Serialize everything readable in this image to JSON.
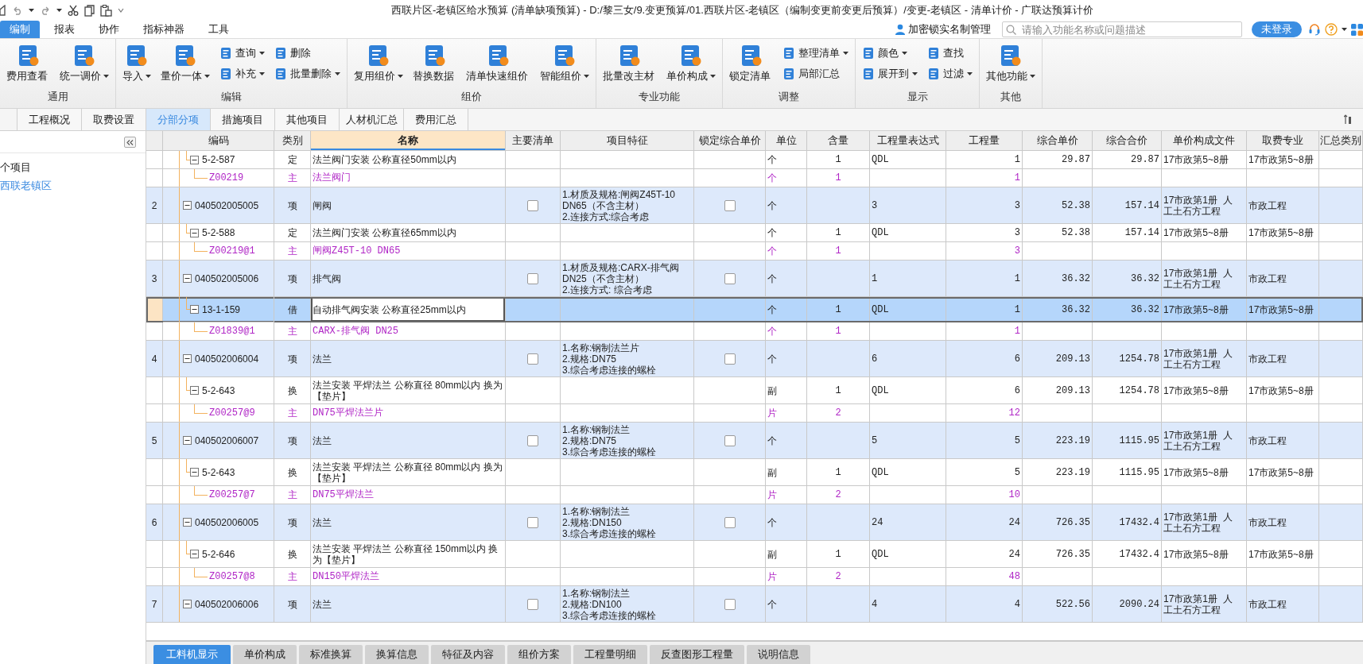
{
  "title_bar": {
    "title": "西联片区-老镇区给水预算 (清单缺项预算) - D:/黎三女/9.变更预算/01.西联片区-老镇区（编制变更前变更后预算）/变更-老镇区 - 清单计价 - 广联达预算计价"
  },
  "menu": {
    "tabs": [
      {
        "label": "编制",
        "selected": true
      },
      {
        "label": "报表",
        "selected": false
      },
      {
        "label": "协作",
        "selected": false
      },
      {
        "label": "指标神器",
        "selected": false
      },
      {
        "label": "工具",
        "selected": false
      }
    ],
    "lock_manager": "加密锁实名制管理",
    "search": {
      "placeholder": "请输入功能名称或问题描述"
    },
    "login_button": "未登录"
  },
  "ribbon": {
    "groups": [
      {
        "label": "通用",
        "items": [
          {
            "kind": "large",
            "label": "费用查看",
            "dropdown": false
          },
          {
            "kind": "large",
            "label": "统一调价",
            "dropdown": true
          }
        ]
      },
      {
        "label": "编辑",
        "items": [
          {
            "kind": "large",
            "label": "导入",
            "dropdown": true
          },
          {
            "kind": "large",
            "label": "量价一体",
            "dropdown": true
          },
          {
            "kind": "small",
            "label": "查询",
            "dropdown": true
          },
          {
            "kind": "small",
            "label": "补充",
            "dropdown": true
          },
          {
            "kind": "small",
            "label": "删除",
            "dropdown": false
          },
          {
            "kind": "small",
            "label": "批量删除",
            "dropdown": true
          }
        ]
      },
      {
        "label": "组价",
        "items": [
          {
            "kind": "large",
            "label": "复用组价",
            "dropdown": true
          },
          {
            "kind": "large",
            "label": "替换数据",
            "dropdown": false
          },
          {
            "kind": "large",
            "label": "清单快速组价",
            "dropdown": false
          },
          {
            "kind": "large",
            "label": "智能组价",
            "dropdown": true
          }
        ]
      },
      {
        "label": "专业功能",
        "items": [
          {
            "kind": "large",
            "label": "批量改主材",
            "dropdown": false
          },
          {
            "kind": "large",
            "label": "单价构成",
            "dropdown": true
          }
        ]
      },
      {
        "label": "调整",
        "items": [
          {
            "kind": "large",
            "label": "锁定清单",
            "dropdown": false
          },
          {
            "kind": "small",
            "label": "整理清单",
            "dropdown": true
          },
          {
            "kind": "small",
            "label": "局部汇总",
            "dropdown": false
          }
        ]
      },
      {
        "label": "显示",
        "items": [
          {
            "kind": "small",
            "label": "颜色",
            "dropdown": true
          },
          {
            "kind": "small",
            "label": "展开到",
            "dropdown": true
          },
          {
            "kind": "small",
            "label": "查找",
            "dropdown": false
          },
          {
            "kind": "small",
            "label": "过滤",
            "dropdown": true
          }
        ]
      },
      {
        "label": "其他",
        "items": [
          {
            "kind": "large",
            "label": "其他功能",
            "dropdown": true
          }
        ]
      }
    ]
  },
  "doc_tabs": [
    {
      "label": "工程概况",
      "selected": false
    },
    {
      "label": "取费设置",
      "selected": false
    },
    {
      "label": "分部分项",
      "selected": true
    },
    {
      "label": "措施项目",
      "selected": false
    },
    {
      "label": "其他项目",
      "selected": false
    },
    {
      "label": "人材机汇总",
      "selected": false
    },
    {
      "label": "费用汇总",
      "selected": false
    }
  ],
  "sidebar": {
    "items": [
      {
        "label": "个项目",
        "selected": false
      },
      {
        "label": "西联老镇区",
        "selected": true
      }
    ]
  },
  "table": {
    "columns": [
      {
        "label": "编码",
        "selected": false
      },
      {
        "label": "类别",
        "selected": false
      },
      {
        "label": "名称",
        "selected": true
      },
      {
        "label": "主要清单",
        "selected": false
      },
      {
        "label": "项目特征",
        "selected": false
      },
      {
        "label": "锁定综合单价",
        "selected": false
      },
      {
        "label": "单位",
        "selected": false
      },
      {
        "label": "含量",
        "selected": false
      },
      {
        "label": "工程量表达式",
        "selected": false
      },
      {
        "label": "工程量",
        "selected": false
      },
      {
        "label": "综合单价",
        "selected": false
      },
      {
        "label": "综合合价",
        "selected": false
      },
      {
        "label": "单价构成文件",
        "selected": false
      },
      {
        "label": "取费专业",
        "selected": false
      },
      {
        "label": "汇总类别",
        "selected": false
      }
    ],
    "rows": [
      {
        "kind": "quota",
        "selected": false,
        "expanded": true,
        "code": "5-2-587",
        "type": "定",
        "name": "法兰阀门安装 公称直径50mm以内",
        "unit": "个",
        "content": "1",
        "expr": "QDL",
        "qty": "1",
        "unit_price": "29.87",
        "total": "29.87",
        "price_file": "17市政第5~8册",
        "fee_type": "17市政第5~8册"
      },
      {
        "kind": "main",
        "selected": false,
        "code": "Z00219",
        "type": "主",
        "name": "法兰阀门",
        "unit": "个",
        "content": "1",
        "qty": "1"
      },
      {
        "kind": "item",
        "selected": false,
        "expanded": true,
        "index": "2",
        "code": "040502005005",
        "type": "项",
        "name": "闸阀",
        "main_list_checked": false,
        "features": "1.材质及规格:闸阀Z45T-10\nDN65（不含主材）\n2.连接方式:综合考虑",
        "price_locked": false,
        "unit": "个",
        "expr": "3",
        "qty": "3",
        "unit_price": "52.38",
        "total": "157.14",
        "price_file": "17市政第1册  人工土石方工程",
        "fee_type": "市政工程"
      },
      {
        "kind": "quota",
        "selected": false,
        "expanded": true,
        "code": "5-2-588",
        "type": "定",
        "name": "法兰阀门安装 公称直径65mm以内",
        "unit": "个",
        "content": "1",
        "expr": "QDL",
        "qty": "3",
        "unit_price": "52.38",
        "total": "157.14",
        "price_file": "17市政第5~8册",
        "fee_type": "17市政第5~8册"
      },
      {
        "kind": "main",
        "selected": false,
        "code": "Z00219@1",
        "type": "主",
        "name": "闸阀Z45T-10 DN65",
        "unit": "个",
        "content": "1",
        "qty": "3"
      },
      {
        "kind": "item",
        "selected": false,
        "expanded": true,
        "index": "3",
        "code": "040502005006",
        "type": "项",
        "name": "排气阀",
        "main_list_checked": false,
        "features": "1.材质及规格:CARX-排气阀\nDN25（不含主材）\n2.连接方式: 综合考虑",
        "price_locked": false,
        "unit": "个",
        "expr": "1",
        "qty": "1",
        "unit_price": "36.32",
        "total": "36.32",
        "price_file": "17市政第1册  人工土石方工程",
        "fee_type": "市政工程"
      },
      {
        "kind": "quota",
        "selected": true,
        "expanded": true,
        "code": "13-1-159",
        "type": "借",
        "name": "自动排气阀安装 公称直径25mm以内",
        "unit": "个",
        "content": "1",
        "expr": "QDL",
        "qty": "1",
        "unit_price": "36.32",
        "total": "36.32",
        "price_file": "17市政第5~8册",
        "fee_type": "17市政第5~8册"
      },
      {
        "kind": "main",
        "selected": false,
        "code": "Z01839@1",
        "type": "主",
        "name": "CARX-排气阀 DN25",
        "unit": "个",
        "content": "1",
        "qty": "1"
      },
      {
        "kind": "item",
        "selected": false,
        "expanded": true,
        "index": "4",
        "code": "040502006004",
        "type": "项",
        "name": "法兰",
        "main_list_checked": false,
        "features": "1.名称:钢制法兰片\n2.规格:DN75\n3.综合考虑连接的螺栓",
        "price_locked": false,
        "unit": "个",
        "expr": "6",
        "qty": "6",
        "unit_price": "209.13",
        "total": "1254.78",
        "price_file": "17市政第1册  人工土石方工程",
        "fee_type": "市政工程"
      },
      {
        "kind": "quota",
        "selected": false,
        "expanded": true,
        "code": "5-2-643",
        "type": "换",
        "name": "法兰安装 平焊法兰 公称直径 80mm以内  换为【垫片】",
        "unit": "副",
        "content": "1",
        "expr": "QDL",
        "qty": "6",
        "unit_price": "209.13",
        "total": "1254.78",
        "price_file": "17市政第5~8册",
        "fee_type": "17市政第5~8册"
      },
      {
        "kind": "main",
        "selected": false,
        "code": "Z00257@9",
        "type": "主",
        "name": "DN75平焊法兰片",
        "unit": "片",
        "content": "2",
        "qty": "12"
      },
      {
        "kind": "item",
        "selected": false,
        "expanded": true,
        "index": "5",
        "code": "040502006007",
        "type": "项",
        "name": "法兰",
        "main_list_checked": false,
        "features": "1.名称:钢制法兰\n2.规格:DN75\n3.综合考虑连接的螺栓",
        "price_locked": false,
        "unit": "个",
        "expr": "5",
        "qty": "5",
        "unit_price": "223.19",
        "total": "1115.95",
        "price_file": "17市政第1册  人工土石方工程",
        "fee_type": "市政工程"
      },
      {
        "kind": "quota",
        "selected": false,
        "expanded": true,
        "code": "5-2-643",
        "type": "换",
        "name": "法兰安装 平焊法兰 公称直径 80mm以内  换为【垫片】",
        "unit": "副",
        "content": "1",
        "expr": "QDL",
        "qty": "5",
        "unit_price": "223.19",
        "total": "1115.95",
        "price_file": "17市政第5~8册",
        "fee_type": "17市政第5~8册"
      },
      {
        "kind": "main",
        "selected": false,
        "code": "Z00257@7",
        "type": "主",
        "name": "DN75平焊法兰",
        "unit": "片",
        "content": "2",
        "qty": "10"
      },
      {
        "kind": "item",
        "selected": false,
        "expanded": true,
        "index": "6",
        "code": "040502006005",
        "type": "项",
        "name": "法兰",
        "main_list_checked": false,
        "features": "1.名称:钢制法兰\n2.规格:DN150\n3.综合考虑连接的螺栓",
        "price_locked": false,
        "unit": "个",
        "expr": "24",
        "qty": "24",
        "unit_price": "726.35",
        "total": "17432.4",
        "price_file": "17市政第1册  人工土石方工程",
        "fee_type": "市政工程"
      },
      {
        "kind": "quota",
        "selected": false,
        "expanded": true,
        "code": "5-2-646",
        "type": "换",
        "name": "法兰安装 平焊法兰 公称直径 150mm以内 换为【垫片】",
        "unit": "副",
        "content": "1",
        "expr": "QDL",
        "qty": "24",
        "unit_price": "726.35",
        "total": "17432.4",
        "price_file": "17市政第5~8册",
        "fee_type": "17市政第5~8册"
      },
      {
        "kind": "main",
        "selected": false,
        "code": "Z00257@8",
        "type": "主",
        "name": "DN150平焊法兰",
        "unit": "片",
        "content": "2",
        "qty": "48"
      },
      {
        "kind": "item",
        "selected": false,
        "expanded": true,
        "index": "7",
        "code": "040502006006",
        "type": "项",
        "name": "法兰",
        "main_list_checked": false,
        "features": "1.名称:钢制法兰\n2.规格:DN100\n3.综合考虑连接的螺栓",
        "price_locked": false,
        "unit": "个",
        "expr": "4",
        "qty": "4",
        "unit_price": "522.56",
        "total": "2090.24",
        "price_file": "17市政第1册  人工土石方工程",
        "fee_type": "市政工程"
      }
    ]
  },
  "bottom_tabs": [
    {
      "label": "工料机显示",
      "selected": true
    },
    {
      "label": "单价构成",
      "selected": false
    },
    {
      "label": "标准换算",
      "selected": false
    },
    {
      "label": "换算信息",
      "selected": false
    },
    {
      "label": "特征及内容",
      "selected": false
    },
    {
      "label": "组价方案",
      "selected": false
    },
    {
      "label": "工程量明细",
      "selected": false
    },
    {
      "label": "反查图形工程量",
      "selected": false
    },
    {
      "label": "说明信息",
      "selected": false
    }
  ]
}
